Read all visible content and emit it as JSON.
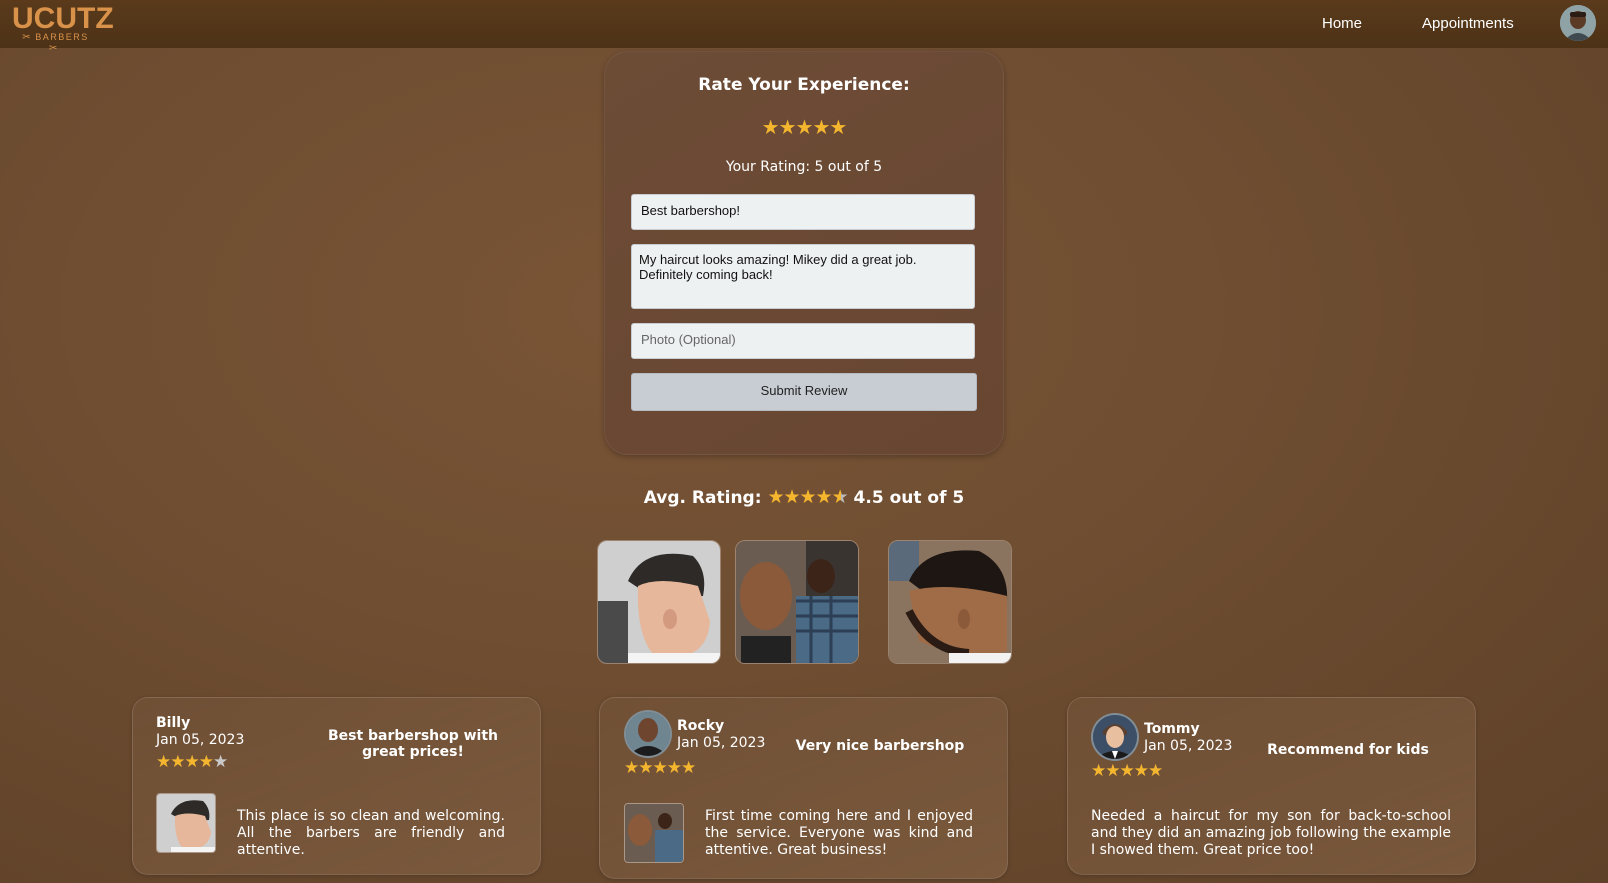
{
  "nav": {
    "logo_main": "UCUTZ",
    "logo_sub": "BARBERS",
    "links": [
      "Home",
      "Appointments"
    ]
  },
  "rate_form": {
    "title": "Rate Your Experience:",
    "stars_selected": 5,
    "stars_total": 5,
    "rating_text": "Your Rating: 5 out of 5",
    "title_value": "Best barbershop!",
    "body_value": "My haircut looks amazing! Mikey did a great job. Definitely coming back!",
    "photo_placeholder": "Photo (Optional)",
    "submit_label": "Submit Review"
  },
  "avg_rating": {
    "label": "Avg. Rating:",
    "value_text": "4.5 out of 5",
    "value": 4.5
  },
  "reviews": [
    {
      "name": "Billy",
      "date": "Jan 05, 2023",
      "rating": 4,
      "title": "Best barbershop with great prices!",
      "text": "This place is so clean and welcoming. All the barbers are friendly and attentive."
    },
    {
      "name": "Rocky",
      "date": "Jan 05, 2023",
      "rating": 5,
      "title": "Very nice barbershop",
      "text": "First time coming here and I enjoyed the service. Everyone was kind and attentive. Great business!"
    },
    {
      "name": "Tommy",
      "date": "Jan 05, 2023",
      "rating": 5,
      "title": "Recommend for kids",
      "text": "Needed a haircut for my son for back-to-school and they did an amazing job following the example I showed them. Great price too!"
    }
  ],
  "colors": {
    "star": "#f4b62e",
    "star_empty": "#c9c9c9",
    "nav_bg": "#523619",
    "logo": "#d8924a"
  }
}
